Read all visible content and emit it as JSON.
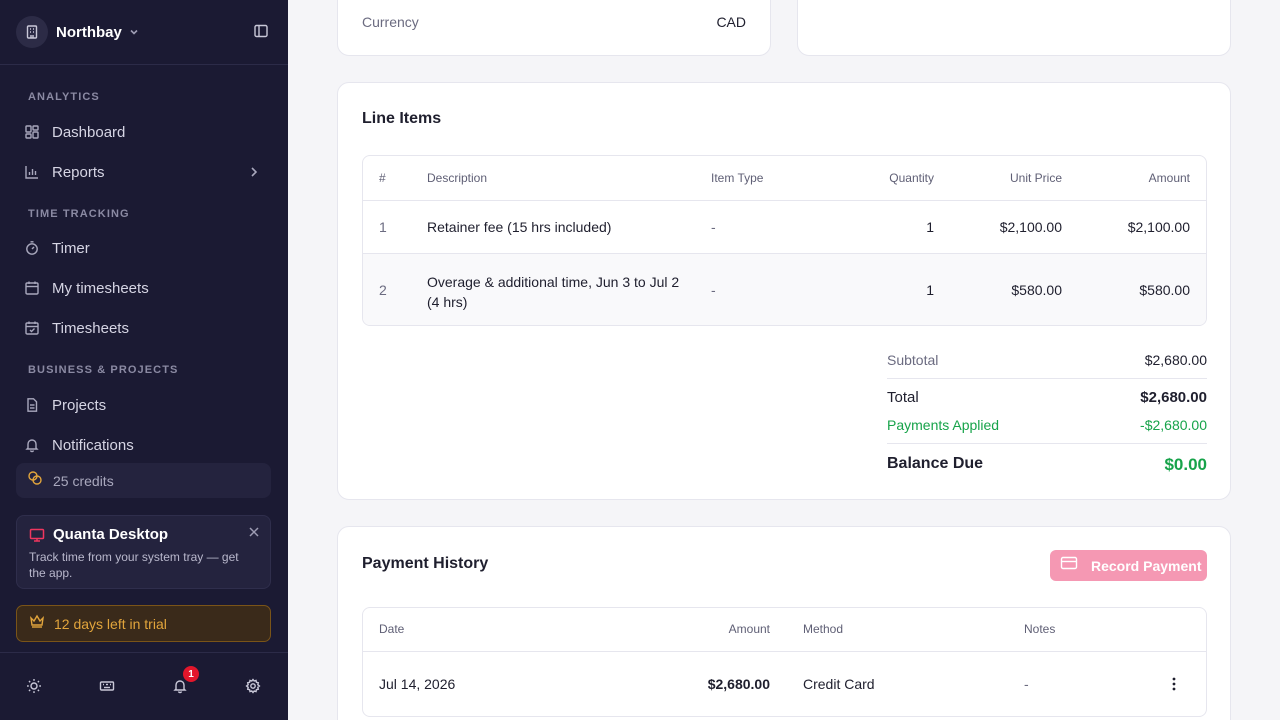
{
  "sidebar": {
    "workspace": "Northbay",
    "sections": {
      "analytics": "ANALYTICS",
      "time_tracking": "TIME TRACKING",
      "business_projects": "BUSINESS & PROJECTS"
    },
    "items": {
      "dashboard": "Dashboard",
      "reports": "Reports",
      "timer": "Timer",
      "my_timesheets": "My timesheets",
      "timesheets": "Timesheets",
      "projects": "Projects",
      "notifications": "Notifications"
    },
    "credits": "25 credits",
    "promo": {
      "title": "Quanta Desktop",
      "text": "Track time from your system tray — get the app."
    },
    "trial": "12 days left in trial",
    "notification_count": "1"
  },
  "invoice": {
    "currency_label": "Currency",
    "currency_value": "CAD"
  },
  "line_items": {
    "title": "Line Items",
    "headers": {
      "num": "#",
      "description": "Description",
      "item_type": "Item Type",
      "quantity": "Quantity",
      "unit_price": "Unit Price",
      "amount": "Amount"
    },
    "rows": [
      {
        "num": "1",
        "description": "Retainer fee (15 hrs included)",
        "item_type": "-",
        "quantity": "1",
        "unit_price": "$2,100.00",
        "amount": "$2,100.00"
      },
      {
        "num": "2",
        "description": "Overage & additional time, Jun 3 to Jul 2 (4 hrs)",
        "item_type": "-",
        "quantity": "1",
        "unit_price": "$580.00",
        "amount": "$580.00"
      }
    ]
  },
  "summary": {
    "subtotal_label": "Subtotal",
    "subtotal_value": "$2,680.00",
    "total_label": "Total",
    "total_value": "$2,680.00",
    "payments_label": "Payments Applied",
    "payments_value": "-$2,680.00",
    "balance_label": "Balance Due",
    "balance_value": "$0.00"
  },
  "payment_history": {
    "title": "Payment History",
    "record_button": "Record Payment",
    "headers": {
      "date": "Date",
      "amount": "Amount",
      "method": "Method",
      "notes": "Notes"
    },
    "rows": [
      {
        "date": "Jul 14, 2026",
        "amount": "$2,680.00",
        "method": "Credit Card",
        "notes": "-"
      }
    ]
  },
  "colors": {
    "sidebar_bg": "#1b1a33",
    "accent_pink": "#f598b3",
    "success_green": "#17a34a",
    "trial_amber": "#e2a53c",
    "badge_red": "#e2162b"
  }
}
